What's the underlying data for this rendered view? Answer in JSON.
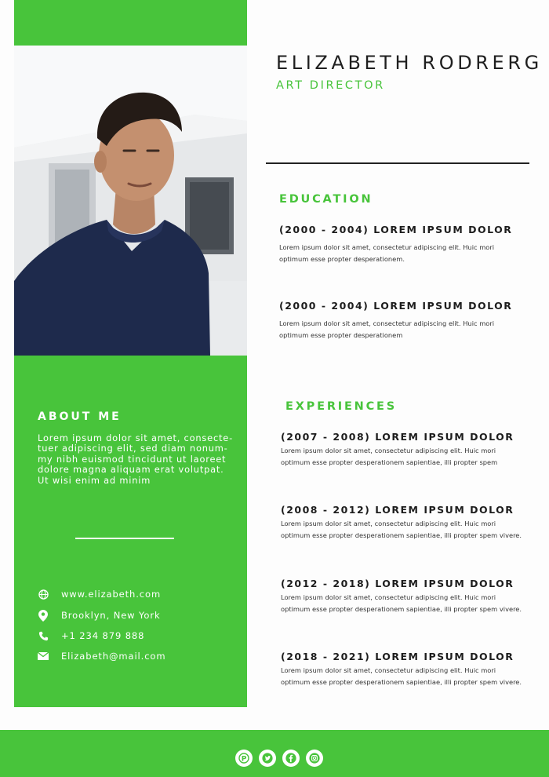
{
  "header": {
    "name": "ELIZABETH RODRERG",
    "role": "ART DIRECTOR"
  },
  "about": {
    "title": "ABOUT ME",
    "lines": [
      "Lorem ipsum dolor sit amet, consecte-",
      "tuer adipiscing elit, sed diam nonum-",
      "my nibh euismod tincidunt ut laoreet",
      "dolore magna aliquam erat volutpat.",
      "Ut wisi enim ad minim"
    ]
  },
  "contact": {
    "website": "www.elizabeth.com",
    "location": "Brooklyn, New York",
    "phone": "+1 234 879 888",
    "email": "Elizabeth@mail.com"
  },
  "education": {
    "title": "EDUCATION",
    "items": [
      {
        "title": "(2000 - 2004) LOREM IPSUM DOLOR",
        "line1": "Lorem ipsum dolor sit amet, consectetur adipiscing elit. Huic mori",
        "line2": "optimum esse propter desperationem."
      },
      {
        "title": "(2000 - 2004) LOREM IPSUM DOLOR",
        "line1": "Lorem ipsum dolor sit amet, consectetur adipiscing elit. Huic mori",
        "line2": "optimum esse propter desperationem"
      }
    ]
  },
  "experiences": {
    "title": "EXPERIENCES",
    "items": [
      {
        "title": "(2007 - 2008) LOREM IPSUM DOLOR",
        "line1": "Lorem ipsum dolor sit amet, consectetur adipiscing elit. Huic mori",
        "line2": "optimum esse propter desperationem sapientiae, illi propter spem"
      },
      {
        "title": "(2008 - 2012) LOREM IPSUM DOLOR",
        "line1": "Lorem ipsum dolor sit amet, consectetur adipiscing elit. Huic mori",
        "line2": "optimum esse propter desperationem sapientiae, illi propter spem vivere."
      },
      {
        "title": "(2012 - 2018) LOREM IPSUM DOLOR",
        "line1": "Lorem ipsum dolor sit amet, consectetur adipiscing elit. Huic mori",
        "line2": "optimum esse propter desperationem sapientiae, illi propter spem vivere."
      },
      {
        "title": "(2018 - 2021) LOREM IPSUM DOLOR",
        "line1": "Lorem ipsum dolor sit amet, consectetur adipiscing elit. Huic mori",
        "line2": "optimum esse propter desperationem sapientiae, illi propter spem vivere."
      }
    ]
  },
  "footer": {
    "social_icons": [
      "pinterest-icon",
      "twitter-icon",
      "facebook-icon",
      "instagram-icon"
    ]
  },
  "colors": {
    "accent": "#48c43b",
    "shirt": "#1e2a4c",
    "text_dark": "#1f1f1f"
  }
}
